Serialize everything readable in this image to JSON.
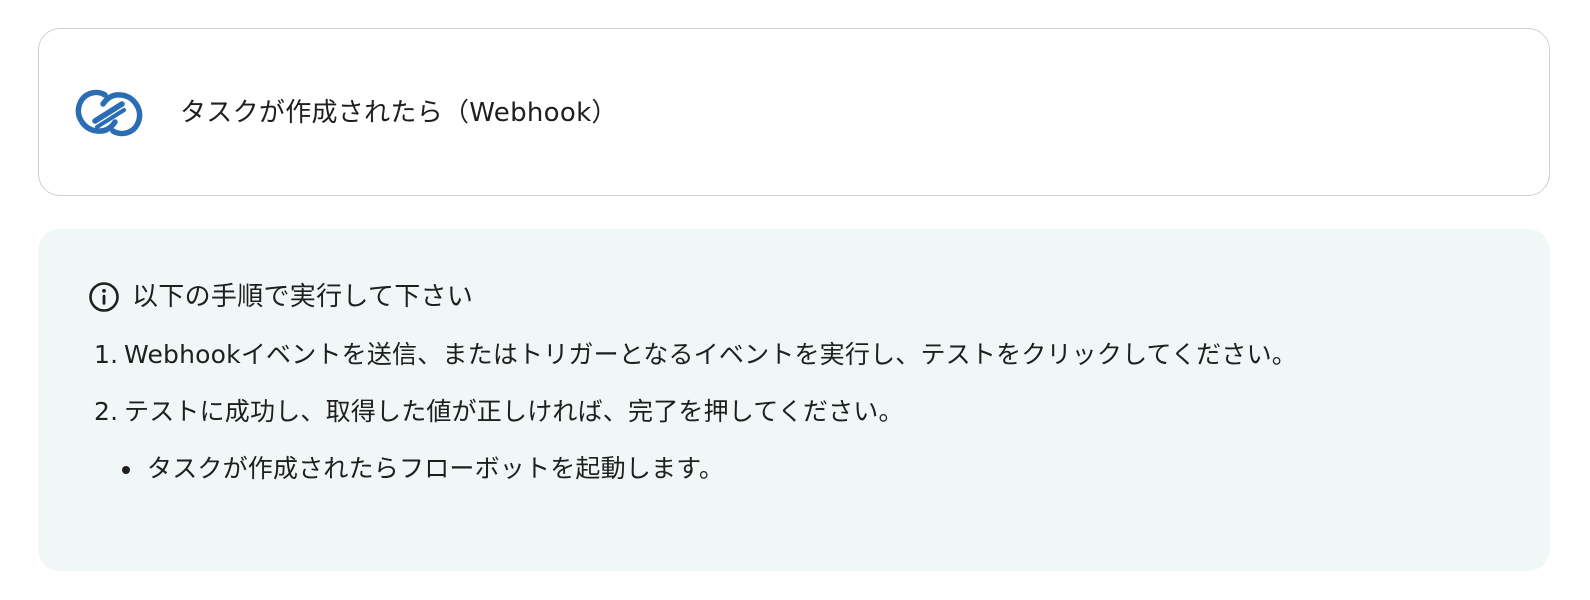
{
  "trigger": {
    "icon": "linked-rings-icon",
    "icon_color": "#2a6db5",
    "title": "タスクが作成されたら（Webhook）"
  },
  "info": {
    "background_color": "#f1f7f7",
    "icon": "info-circle-icon",
    "heading": "以下の手順で実行して下さい",
    "steps": [
      {
        "number": "1.",
        "text": "Webhookイベントを送信、またはトリガーとなるイベントを実行し、テストをクリックしてください。"
      },
      {
        "number": "2.",
        "text": "テストに成功し、取得した値が正しければ、完了を押してください。"
      }
    ],
    "sub_items": [
      {
        "text": "タスクが作成されたらフローボットを起動します。"
      }
    ]
  }
}
